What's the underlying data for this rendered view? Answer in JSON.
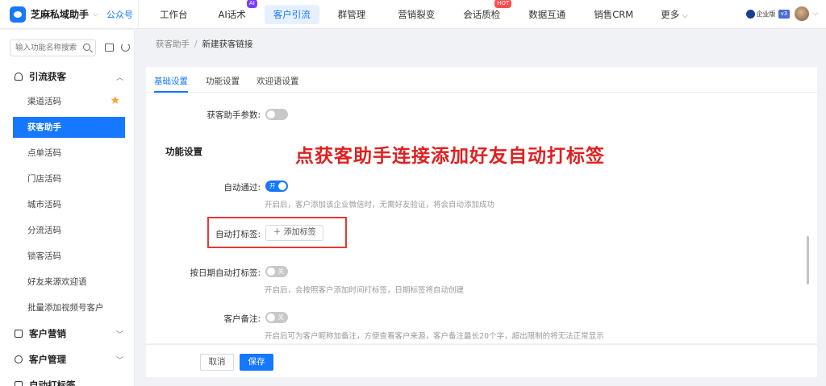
{
  "brand": {
    "name": "芝麻私域助手",
    "account_type": "公众号"
  },
  "nav": {
    "items": [
      {
        "label": "工作台"
      },
      {
        "label": "AI话术",
        "badge": "AI"
      },
      {
        "label": "客户引流"
      },
      {
        "label": "群管理"
      },
      {
        "label": "营销裂变"
      },
      {
        "label": "会话质检",
        "badge": "HOT"
      },
      {
        "label": "数据互通"
      },
      {
        "label": "销售CRM"
      },
      {
        "label": "更多"
      }
    ],
    "active": "客户引流"
  },
  "user": {
    "enterprise_label": "企业版",
    "version": "v3"
  },
  "sidebar": {
    "search_placeholder": "输入功能名称搜索",
    "groups": [
      {
        "label": "引流获客",
        "expanded": true
      },
      {
        "label": "客户营销",
        "expanded": false
      },
      {
        "label": "客户管理",
        "expanded": false
      },
      {
        "label": "自动打标签",
        "expanded": true
      }
    ],
    "items": [
      {
        "label": "渠道活码",
        "starred": true
      },
      {
        "label": "获客助手",
        "active": true
      },
      {
        "label": "点单活码"
      },
      {
        "label": "门店活码"
      },
      {
        "label": "城市活码"
      },
      {
        "label": "分流活码"
      },
      {
        "label": "锁客活码"
      },
      {
        "label": "好友来源欢迎语"
      },
      {
        "label": "批量添加视频号客户"
      }
    ]
  },
  "breadcrumb": {
    "parent": "获客助手",
    "separator": "/",
    "current": "新建获客链接"
  },
  "tabs": [
    {
      "label": "基础设置"
    },
    {
      "label": "功能设置"
    },
    {
      "label": "欢迎语设置"
    }
  ],
  "active_tab": "基础设置",
  "form": {
    "param_label": "获客助手参数:",
    "section_title": "功能设置",
    "auto_pass": {
      "label": "自动通过:",
      "toggle": "开",
      "on": true,
      "hint": "开启后，客户添加该企业微信时，无需好友验证，将会自动添加成功"
    },
    "auto_tag": {
      "label": "自动打标签:",
      "button": "添加标签"
    },
    "date_tag": {
      "label": "按日期自动打标签:",
      "toggle": "关",
      "on": false,
      "hint": "开启后，会按照客户添加时间打标签，日期标签将自动创建"
    },
    "remark": {
      "label": "客户备注:",
      "toggle": "关",
      "on": false,
      "hint": "开启后可为客户昵称加备注，方便查看客户来源，客户备注最长20个字，超出限制的将无法正常显示"
    }
  },
  "annotation": "点获客助手连接添加好友自动打标签",
  "footer": {
    "cancel": "取消",
    "save": "保存"
  }
}
